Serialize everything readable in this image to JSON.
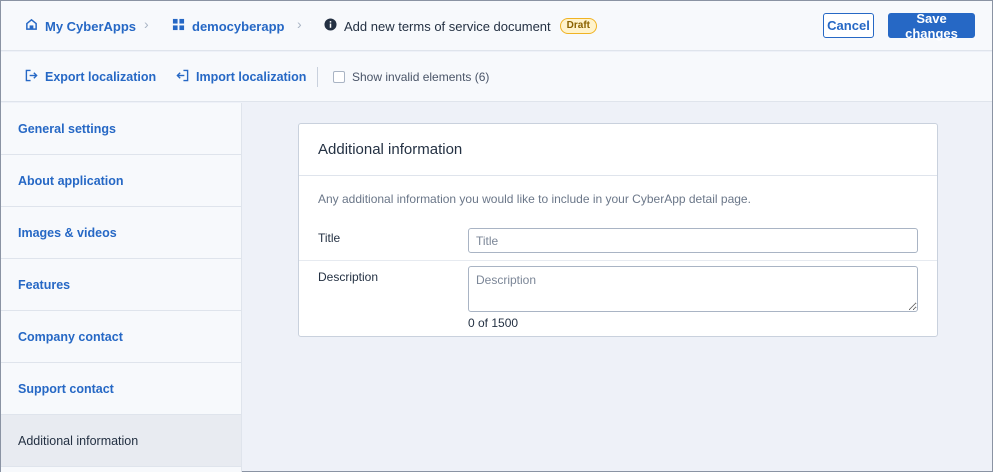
{
  "header": {
    "crumbs": [
      {
        "label": "My CyberApps",
        "icon": "store-icon"
      },
      {
        "label": "democyberapp",
        "icon": "grid-icon"
      }
    ],
    "current": {
      "label": "Add new terms of service document",
      "icon": "info-icon"
    },
    "status_badge": "Draft",
    "cancel_label": "Cancel",
    "save_label": "Save changes"
  },
  "toolbar": {
    "export_label": "Export localization",
    "import_label": "Import localization",
    "show_invalid_label": "Show invalid elements (6)",
    "show_invalid_checked": false
  },
  "sidebar": {
    "items": [
      {
        "label": "General settings"
      },
      {
        "label": "About application"
      },
      {
        "label": "Images & videos"
      },
      {
        "label": "Features"
      },
      {
        "label": "Company contact"
      },
      {
        "label": "Support contact"
      },
      {
        "label": "Additional information"
      }
    ],
    "active_index": 6
  },
  "form": {
    "title": "Additional information",
    "description": "Any additional information you would like to include in your CyberApp detail page.",
    "title_field": {
      "label": "Title",
      "placeholder": "Title",
      "value": ""
    },
    "description_field": {
      "label": "Description",
      "placeholder": "Description",
      "value": ""
    },
    "counter": "0 of 1500"
  },
  "colors": {
    "accent": "#2668c5",
    "badge_border": "#f0b323"
  }
}
